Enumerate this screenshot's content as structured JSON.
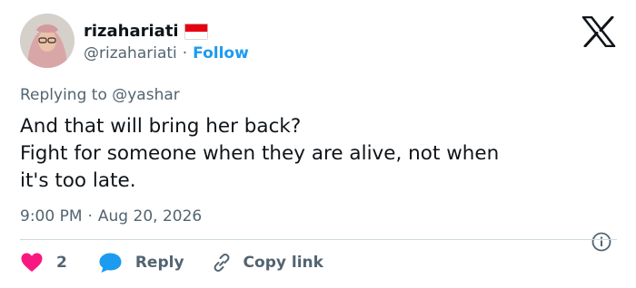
{
  "user": {
    "display_name": "rizahariati",
    "handle": "@rizahariati",
    "separator": "·",
    "follow_label": "Follow",
    "flag_icon": "indonesia-flag-icon"
  },
  "tweet": {
    "replying_prefix": "Replying to",
    "replying_to": "@yashar",
    "lines": [
      "And that will bring her back?",
      "Fight for someone when they are alive, not when",
      "it's too late."
    ],
    "time": "9:00 PM",
    "separator": "·",
    "date": "Aug 20, 2026"
  },
  "actions": {
    "like_count": "2",
    "reply_label": "Reply",
    "copy_link_label": "Copy link"
  },
  "colors": {
    "accent": "#1d9bf0",
    "like": "#f91880",
    "secondary_text": "#536471",
    "primary_text": "#0f1419",
    "divider": "#cfd9de",
    "flag_red": "#e70011"
  }
}
